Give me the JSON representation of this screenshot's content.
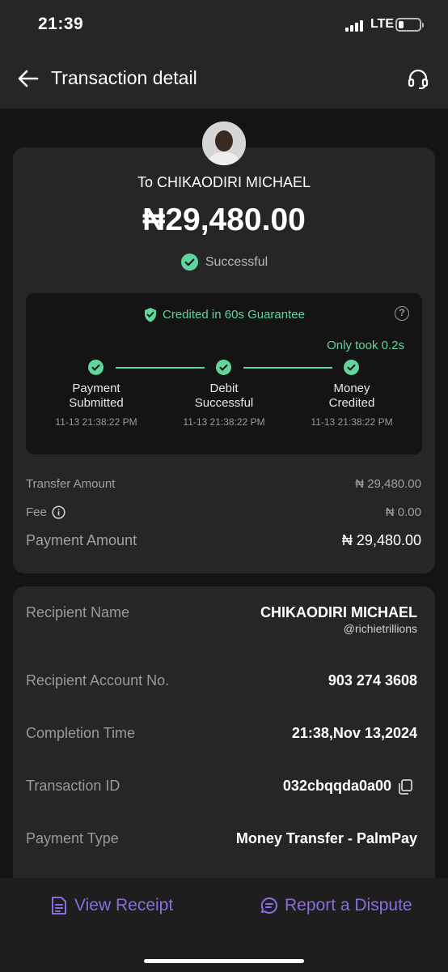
{
  "status_bar": {
    "time": "21:39",
    "network": "LTE",
    "battery_level": 0.25
  },
  "header": {
    "title": "Transaction detail",
    "back_icon": "arrow-left-icon",
    "support_icon": "headset-icon"
  },
  "summary": {
    "recipient_line": "To CHIKAODIRI MICHAEL",
    "amount": "₦29,480.00",
    "status": "Successful",
    "guarantee": {
      "title": "Credited in 60s Guarantee",
      "help": "?",
      "took": "Only took 0.2s",
      "steps": [
        {
          "label_1": "Payment",
          "label_2": "Submitted",
          "time": "11-13 21:38:22 PM"
        },
        {
          "label_1": "Debit",
          "label_2": "Successful",
          "time": "11-13 21:38:22 PM"
        },
        {
          "label_1": "Money",
          "label_2": "Credited",
          "time": "11-13 21:38:22 PM"
        }
      ]
    },
    "transfer_amount": {
      "label": "Transfer Amount",
      "value": "₦ 29,480.00"
    },
    "fee": {
      "label": "Fee",
      "value": "₦ 0.00"
    },
    "payment_amount": {
      "label": "Payment Amount",
      "value": "₦ 29,480.00"
    }
  },
  "details": {
    "recipient_name": {
      "label": "Recipient Name",
      "value": "CHIKAODIRI MICHAEL",
      "handle": "@richietrillions"
    },
    "account_no": {
      "label": "Recipient Account No.",
      "value": "903 274 3608"
    },
    "completion_time": {
      "label": "Completion Time",
      "value": "21:38,Nov 13,2024"
    },
    "transaction_id": {
      "label": "Transaction ID",
      "value": "032cbqqda0a00"
    },
    "payment_type": {
      "label": "Payment Type",
      "value": "Money Transfer - PalmPay"
    }
  },
  "actions": {
    "view_receipt": "View Receipt",
    "report_dispute": "Report a Dispute"
  },
  "colors": {
    "success": "#5fd69b",
    "accent": "#8c6ce0",
    "card": "#262626",
    "background": "#141414"
  }
}
